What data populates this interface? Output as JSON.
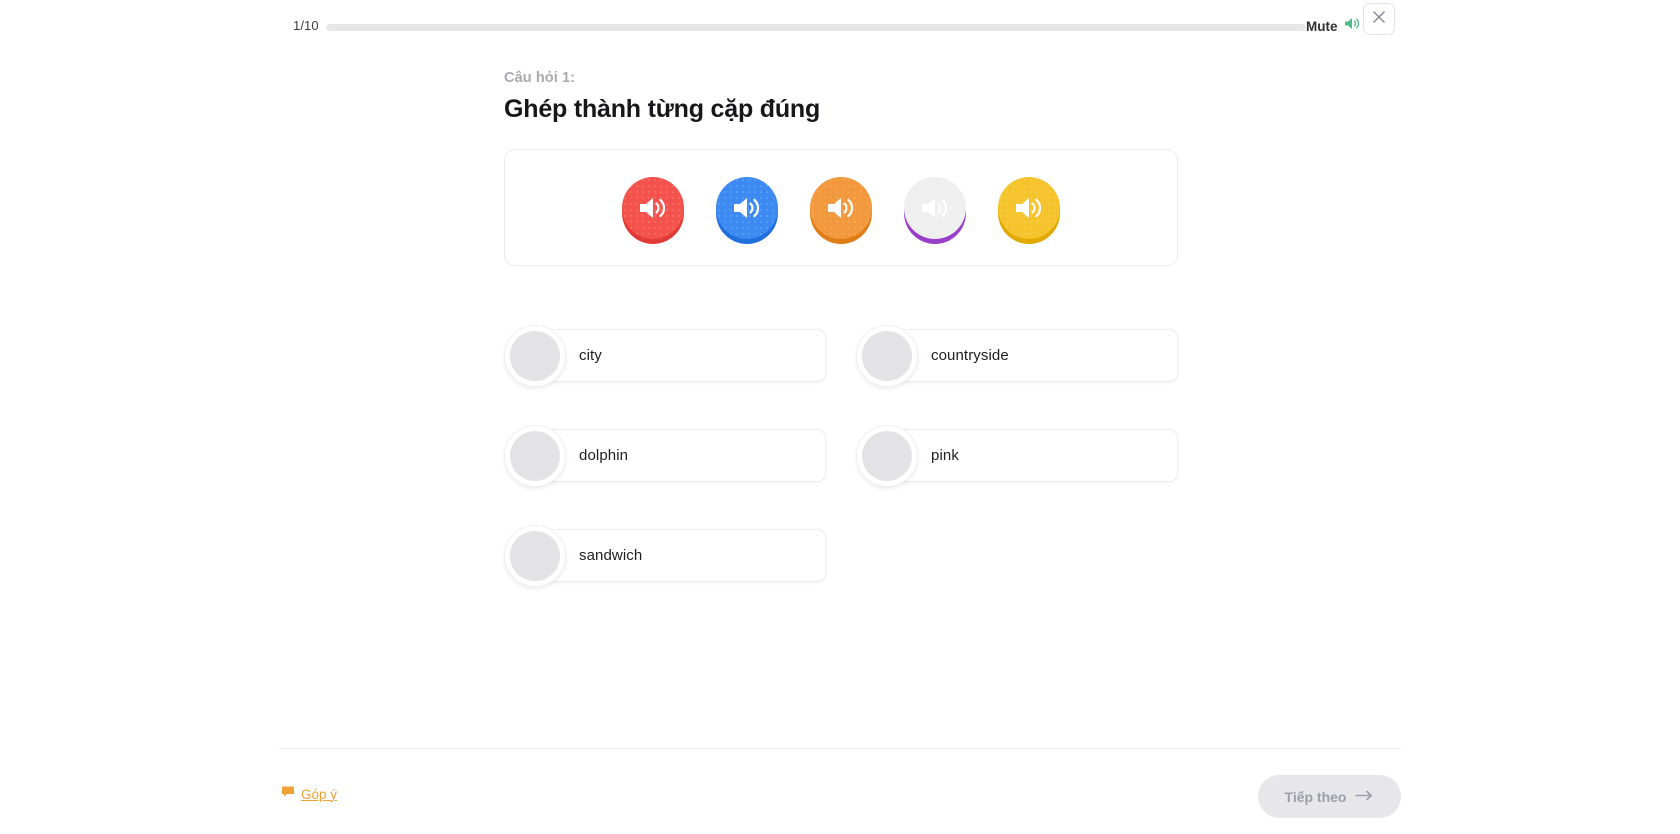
{
  "topbar": {
    "progress_counter": "1/10",
    "progress_percent": 0,
    "mute_label": "Mute",
    "mute_icon": "speaker-on-icon",
    "mute_icon_color": "#4cbf87",
    "close_icon": "close-icon"
  },
  "content": {
    "question_label": "Câu hỏi 1:",
    "question_title": "Ghép thành từng cặp đúng"
  },
  "audio_buttons": [
    {
      "icon": "speaker-icon",
      "color": "#f4524c",
      "shadow": "#e03b35",
      "name": "audio-button-1"
    },
    {
      "icon": "speaker-icon",
      "color": "#3d8bf2",
      "shadow": "#1f6fdc",
      "name": "audio-button-2"
    },
    {
      "icon": "speaker-icon",
      "color": "#f3993d",
      "shadow": "#e07d17",
      "name": "audio-button-3"
    },
    {
      "icon": "speaker-icon",
      "color": "#b濃",
      "name": "audio-button-4"
    },
    {
      "icon": "speaker-icon",
      "color": "#f5c32c",
      "shadow": "#e0a800",
      "name": "audio-button-5"
    }
  ],
  "audio_button_colors": [
    {
      "fill": "#f4524c",
      "shadow": "#e03b35"
    },
    {
      "fill": "#3d8bf2",
      "shadow": "#1f6fdc"
    },
    {
      "fill": "#f3993d",
      "shadow": "#e07d17"
    },
    {
      "fill": "#b濃6de",
      "shadow": "#9a3fc9"
    },
    {
      "fill": "#f5c32c",
      "shadow": "#e0a800"
    }
  ],
  "match_items": [
    {
      "word": "city",
      "column": "left"
    },
    {
      "word": "countryside",
      "column": "right"
    },
    {
      "word": "dolphin",
      "column": "left"
    },
    {
      "word": "pink",
      "column": "right"
    },
    {
      "word": "sandwich",
      "column": "left"
    }
  ],
  "footer": {
    "feedback_label": "Góp ý",
    "feedback_icon": "speech-bubble-icon",
    "feedback_color": "#f0a138",
    "next_label": "Tiếp theo",
    "next_icon": "arrow-right-icon",
    "next_enabled": false
  }
}
